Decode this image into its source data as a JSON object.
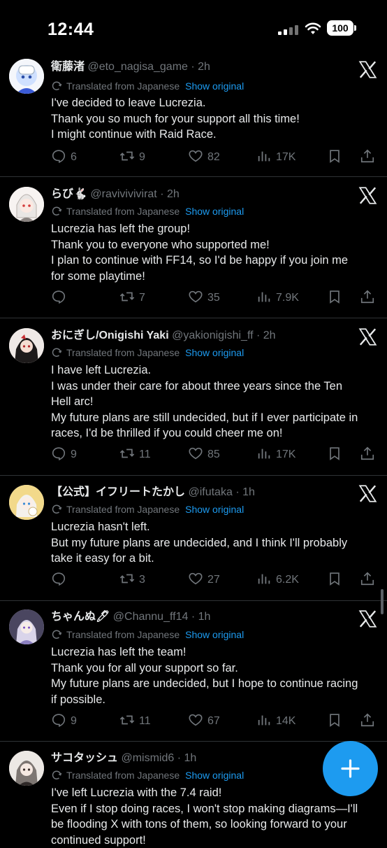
{
  "status_bar": {
    "time": "12:44",
    "battery": "100"
  },
  "labels": {
    "translated": "Translated from Japanese",
    "show_original": "Show original"
  },
  "tweets": [
    {
      "name": "衛藤渚",
      "handle": "@eto_nagisa_game",
      "time": "· 2h",
      "lines": [
        "I've decided to leave Lucrezia.",
        "Thank you so much for your support all this time!",
        "I might continue with Raid Race."
      ],
      "replies": "6",
      "reposts": "9",
      "likes": "82",
      "views": "17K"
    },
    {
      "name": "らび🐇",
      "handle": "@ravivivivirat",
      "time": "· 2h",
      "lines": [
        "Lucrezia has left the group!",
        "Thank you to everyone who supported me!",
        "I plan to continue with FF14, so I'd be happy if you join me",
        "for some playtime!"
      ],
      "replies": "",
      "reposts": "7",
      "likes": "35",
      "views": "7.9K"
    },
    {
      "name": "おにぎし/Onigishi Yaki",
      "handle": "@yakionigishi_ff",
      "time": "· 2h",
      "lines": [
        "I have left Lucrezia.",
        "I was under their care for about three years since the Ten",
        "Hell arc!",
        "My future plans are still undecided, but if I ever participate in",
        "races, I'd be thrilled if you could cheer me on!"
      ],
      "replies": "9",
      "reposts": "11",
      "likes": "85",
      "views": "17K"
    },
    {
      "name": "【公式】イフリートたかし",
      "handle": "@ifutaka",
      "time": "· 1h",
      "lines": [
        "Lucrezia hasn't left.",
        "But my future plans are undecided, and I think I'll probably",
        "take it easy for a bit."
      ],
      "replies": "",
      "reposts": "3",
      "likes": "27",
      "views": "6.2K"
    },
    {
      "name": "ちゃんぬ🖊",
      "handle": "@Channu_ff14",
      "time": "· 1h",
      "lines": [
        "Lucrezia has left the team!",
        "Thank you for all your support so far.",
        "My future plans are undecided, but I hope to continue racing",
        "if possible."
      ],
      "replies": "9",
      "reposts": "11",
      "likes": "67",
      "views": "14K"
    },
    {
      "name": "サコタッシュ",
      "handle": "@mismid6",
      "time": "· 1h",
      "lines": [
        "I've left Lucrezia with the 7.4 raid!",
        "Even if I stop doing races, I won't stop making diagrams—I'll",
        "be flooding X with tons of them, so looking forward to your",
        "continued support!"
      ],
      "replies": "",
      "reposts": "",
      "likes": "",
      "views": ""
    }
  ],
  "icons": [
    "x-logo-icon",
    "translate-icon",
    "reply-icon",
    "repost-icon",
    "like-icon",
    "views-icon",
    "bookmark-icon",
    "share-icon",
    "compose-plus-icon"
  ],
  "colors": {
    "background": "#000000",
    "text": "#e7e9ea",
    "muted": "#71767b",
    "accent": "#1d9bf0",
    "divider": "#2f3336"
  }
}
